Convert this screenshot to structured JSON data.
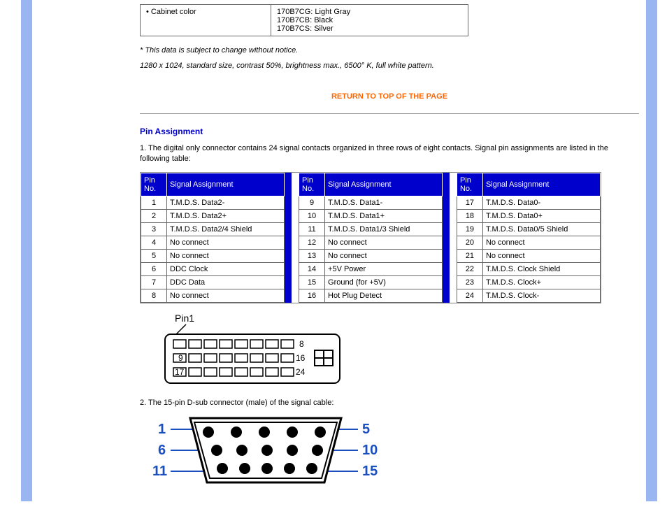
{
  "cabinet": {
    "label": "• Cabinet color",
    "colors": [
      "170B7CG: Light Gray",
      "170B7CB: Black",
      "170B7CS: Silver"
    ]
  },
  "notes": {
    "change": "* This data is subject to change without notice.",
    "spec": "1280 x 1024, standard size, contrast 50%, brightness max., 6500° K, full white pattern."
  },
  "return_link": "RETURN TO TOP OF THE PAGE",
  "pin_section": {
    "heading": "Pin Assignment",
    "intro": "1. The digital only connector contains 24 signal contacts organized in three rows of eight contacts. Signal pin assignments are listed in the following table:",
    "headers": {
      "pin": "Pin No.",
      "signal": "Signal Assignment"
    },
    "group1": [
      {
        "no": "1",
        "sig": "T.M.D.S. Data2-"
      },
      {
        "no": "2",
        "sig": "T.M.D.S. Data2+"
      },
      {
        "no": "3",
        "sig": "T.M.D.S. Data2/4 Shield"
      },
      {
        "no": "4",
        "sig": "No connect"
      },
      {
        "no": "5",
        "sig": "No connect"
      },
      {
        "no": "6",
        "sig": "DDC Clock"
      },
      {
        "no": "7",
        "sig": "DDC Data"
      },
      {
        "no": "8",
        "sig": "No connect"
      }
    ],
    "group2": [
      {
        "no": "9",
        "sig": "T.M.D.S. Data1-"
      },
      {
        "no": "10",
        "sig": "T.M.D.S. Data1+"
      },
      {
        "no": "11",
        "sig": "T.M.D.S. Data1/3 Shield"
      },
      {
        "no": "12",
        "sig": "No connect"
      },
      {
        "no": "13",
        "sig": "No connect"
      },
      {
        "no": "14",
        "sig": "+5V Power"
      },
      {
        "no": "15",
        "sig": "Ground (for +5V)"
      },
      {
        "no": "16",
        "sig": "Hot Plug Detect"
      }
    ],
    "group3": [
      {
        "no": "17",
        "sig": "T.M.D.S. Data0-"
      },
      {
        "no": "18",
        "sig": "T.M.D.S. Data0+"
      },
      {
        "no": "19",
        "sig": "T.M.D.S. Data0/5 Shield"
      },
      {
        "no": "20",
        "sig": "No connect"
      },
      {
        "no": "21",
        "sig": "No connect"
      },
      {
        "no": "22",
        "sig": "T.M.D.S. Clock Shield"
      },
      {
        "no": "23",
        "sig": "T.M.D.S. Clock+"
      },
      {
        "no": "24",
        "sig": "T.M.D.S. Clock-"
      }
    ],
    "diagram1_labels": {
      "pin1": "Pin1",
      "n8": "8",
      "n9": "9",
      "n16": "16",
      "n17": "17",
      "n24": "24"
    },
    "dsub_intro": "2. The 15-pin D-sub connector (male) of the signal cable:",
    "dsub_labels": {
      "l1": "1",
      "l5": "5",
      "l6": "6",
      "l10": "10",
      "l11": "11",
      "l15": "15"
    }
  }
}
